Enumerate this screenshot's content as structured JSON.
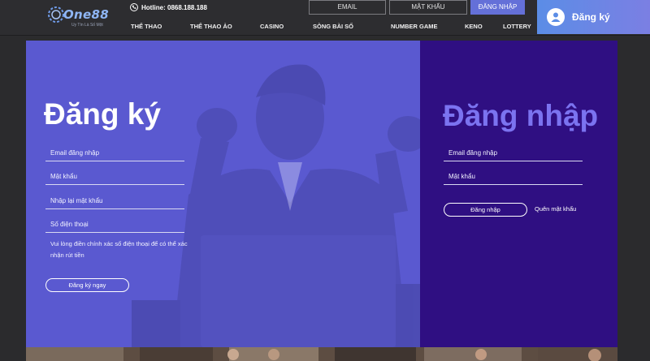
{
  "header": {
    "logo_text": "One88",
    "logo_tagline": "Uy Tín Là Số Một",
    "hotline": "Hotline: 0868.188.188",
    "email_placeholder": "EMAIL",
    "password_placeholder": "MẬT KHẨU",
    "login_button": "ĐĂNG NHẬP",
    "register_button": "Đăng ký",
    "nav": [
      "THỂ THAO",
      "THỂ THAO ẢO",
      "CASINO",
      "SÒNG BÀI SỐ",
      "NUMBER GAME",
      "KENO",
      "LOTTERY"
    ]
  },
  "register": {
    "title": "Đăng ký",
    "fields": [
      "Email đăng nhập",
      "Mật khẩu",
      "Nhập lại mật khẩu",
      "Số điện thoại"
    ],
    "note": "Vui lòng điền chính xác số điện thoại để có thể xác nhận rút tiền",
    "submit": "Đăng ký ngay"
  },
  "login": {
    "title": "Đăng nhập",
    "fields": [
      "Email đăng nhập",
      "Mật khẩu"
    ],
    "submit": "Đăng nhập",
    "forgot": "Quên mật khẩu"
  },
  "colors": {
    "header_bg": "#2d2d30",
    "register_panel": "#5a59d0",
    "login_panel": "#2f0f82",
    "login_title": "#7b73f0",
    "accent_button": "#6470d8"
  }
}
